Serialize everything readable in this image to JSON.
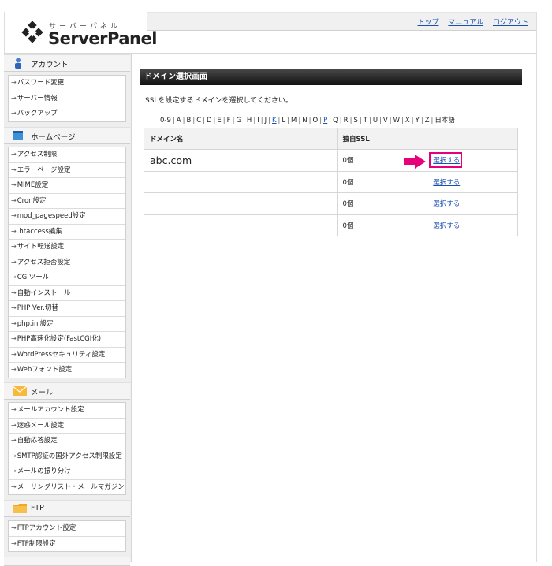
{
  "brand": {
    "kana": "サーバーパネル",
    "name": "ServerPanel"
  },
  "top_links": [
    "トップ",
    "マニュアル",
    "ログアウト"
  ],
  "sidebar": {
    "account": {
      "title": "アカウント",
      "items": [
        "パスワード変更",
        "サーバー情報",
        "バックアップ"
      ]
    },
    "homepage": {
      "title": "ホームページ",
      "items": [
        "アクセス制限",
        "エラーページ設定",
        "MIME設定",
        "Cron設定",
        "mod_pagespeed設定",
        ".htaccess編集",
        "サイト転送設定",
        "アクセス拒否設定",
        "CGIツール",
        "自動インストール",
        "PHP Ver.切替",
        "php.ini設定",
        "PHP高速化設定(FastCGI化)",
        "WordPressセキュリティ設定",
        "Webフォント設定"
      ]
    },
    "mail": {
      "title": "メール",
      "items": [
        "メールアカウント設定",
        "迷惑メール設定",
        "自動応答設定",
        "SMTP認証の国外アクセス制限設定",
        "メールの振り分け",
        "メーリングリスト・メールマガジン"
      ]
    },
    "ftp": {
      "title": "FTP",
      "items": [
        "FTPアカウント設定",
        "FTP制限設定"
      ]
    }
  },
  "main": {
    "title": "ドメイン選択画面",
    "instruction": "SSLを設定するドメインを選択してください。",
    "alpha_index": [
      "0-9",
      "A",
      "B",
      "C",
      "D",
      "E",
      "F",
      "G",
      "H",
      "I",
      "J",
      "K",
      "L",
      "M",
      "N",
      "O",
      "P",
      "Q",
      "R",
      "S",
      "T",
      "U",
      "V",
      "W",
      "X",
      "Y",
      "Z",
      "日本語"
    ],
    "alpha_active": [
      "K",
      "P"
    ],
    "table": {
      "headers": [
        "ドメイン名",
        "独自SSL",
        ""
      ],
      "rows": [
        {
          "domain": "abc.com",
          "ssl": "0個",
          "action": "選択する"
        },
        {
          "domain": "",
          "ssl": "0個",
          "action": "選択する"
        },
        {
          "domain": "",
          "ssl": "0個",
          "action": "選択する"
        },
        {
          "domain": "",
          "ssl": "0個",
          "action": "選択する"
        }
      ]
    }
  },
  "colors": {
    "highlight": "#e6007a",
    "link": "#1a4fb3",
    "header_bar": "#111111"
  },
  "icons": {
    "account": "person-icon",
    "homepage": "page-icon",
    "mail": "envelope-icon",
    "ftp": "folder-icon"
  }
}
